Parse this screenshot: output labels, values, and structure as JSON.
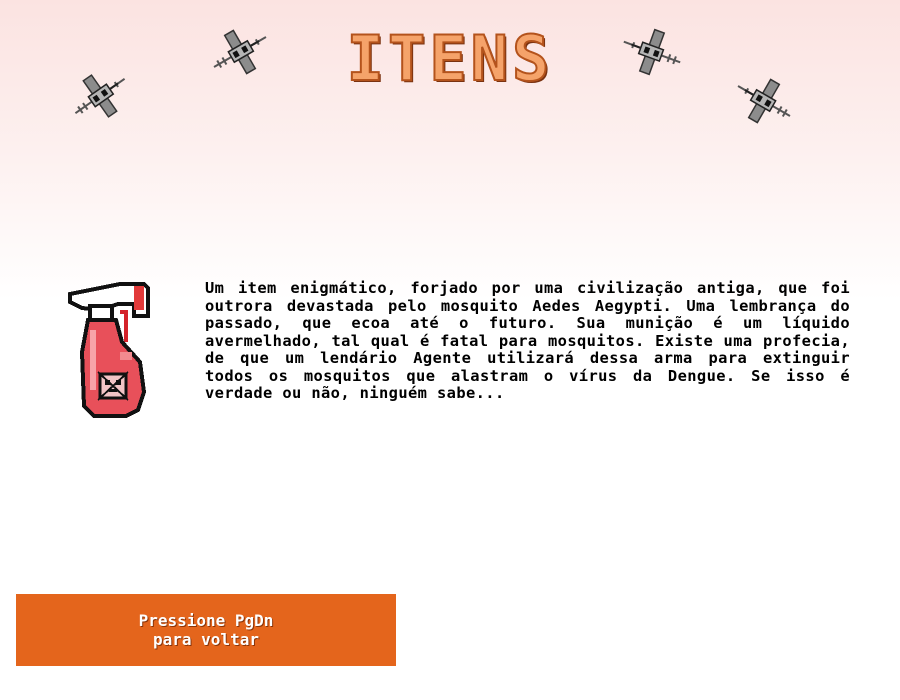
{
  "screen": {
    "title": "ITENS",
    "description": "Um item enigmático, forjado por uma civilização antiga, que foi outrora devastada pelo mosquito Aedes Aegypti. Uma lembrança do passado, que ecoa até o futuro. Sua munição é um líquido avermelhado, tal qual é fatal para mosquitos. Existe uma profecia, de que um lendário Agente utilizará dessa arma para extinguir todos os mosquitos que alastram o vírus da Dengue. Se isso é verdade ou não, ninguém sabe...",
    "back_button": "Pressione PgDn\npara voltar"
  },
  "item": {
    "icon": "spray-bottle-icon"
  },
  "decorations": {
    "icon": "mosquito-icon",
    "count": 4
  },
  "colors": {
    "title_fill": "#f5a36a",
    "title_outline": "#b4531c",
    "button": "#e4651c",
    "spray_body": "#e8505a",
    "mosquito": "#8c8c8c"
  }
}
